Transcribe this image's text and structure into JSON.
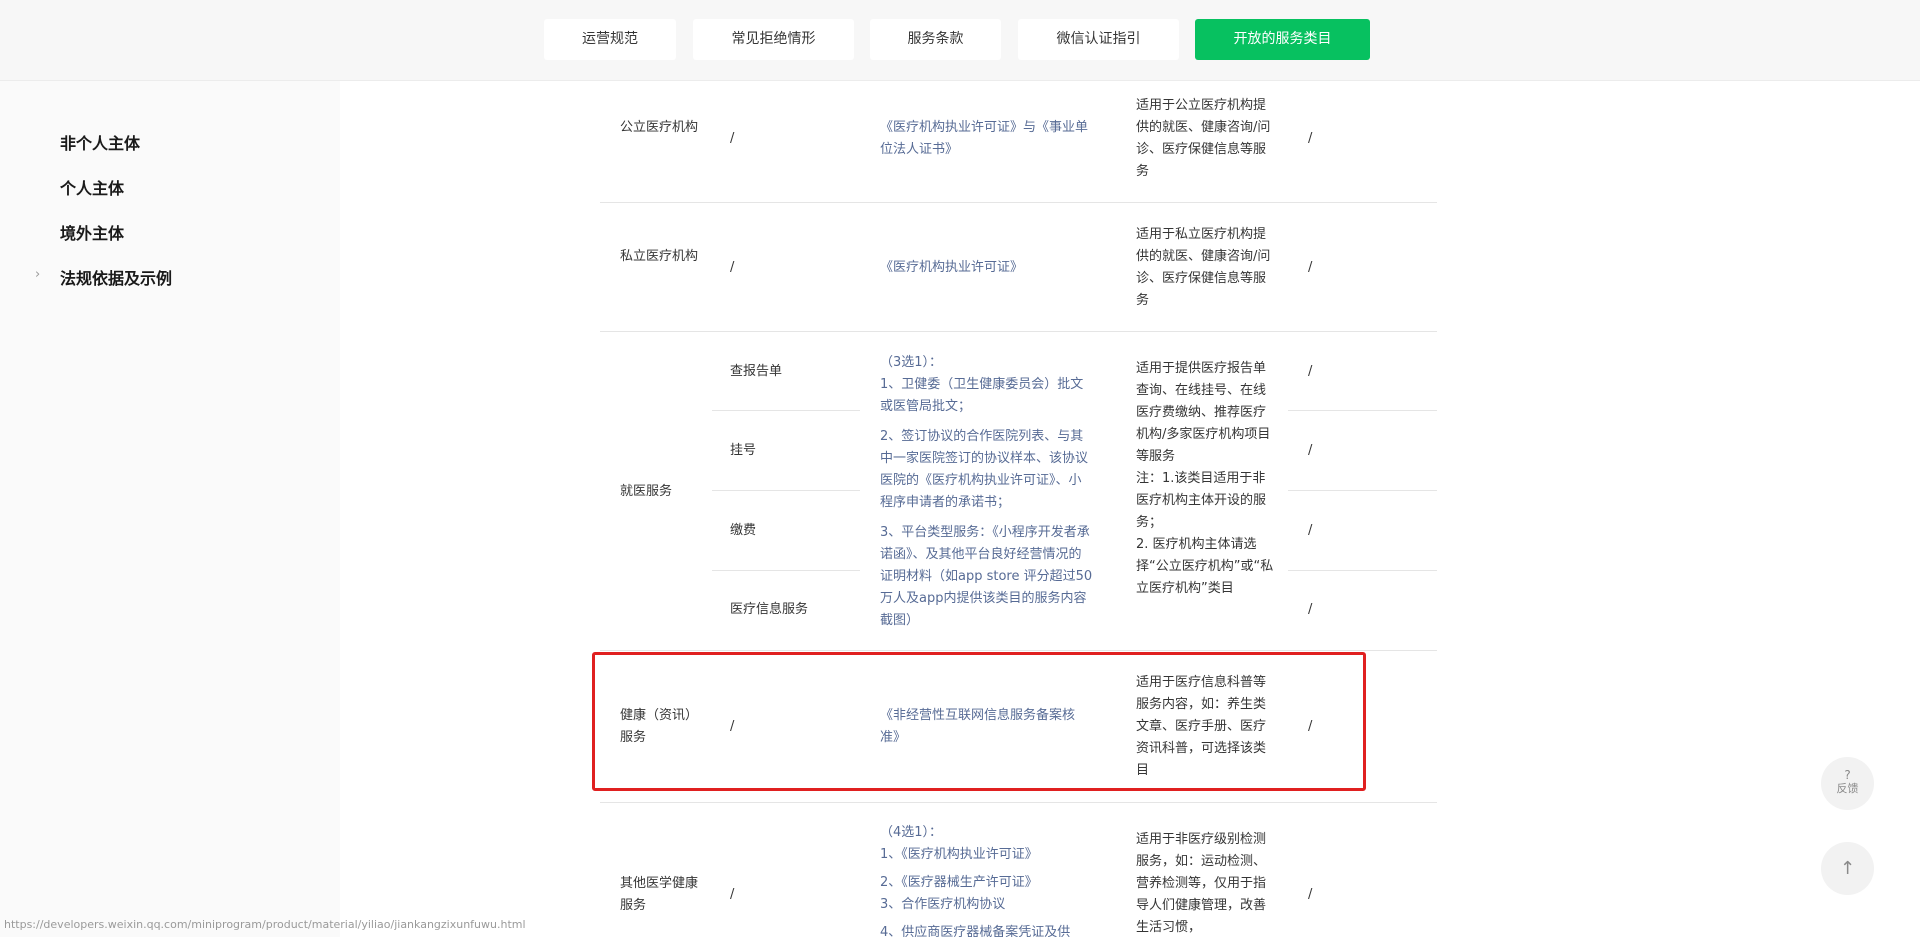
{
  "nav": {
    "buttons": [
      {
        "label": "运营规范"
      },
      {
        "label": "常见拒绝情形"
      },
      {
        "label": "服务条款"
      },
      {
        "label": "微信认证指引"
      },
      {
        "label": "开放的服务类目"
      }
    ]
  },
  "sidebar": {
    "items": [
      {
        "label": "非个人主体"
      },
      {
        "label": "个人主体"
      },
      {
        "label": "境外主体"
      },
      {
        "label": "法规依据及示例"
      }
    ],
    "caret": "›"
  },
  "table": {
    "slash": "/",
    "public": {
      "name": "公立医疗机构",
      "qual": "《医疗机构执业许可证》与《事业单位法人证书》",
      "desc": "适用于公立医疗机构提供的就医、健康咨询/问诊、医疗保健信息等服务"
    },
    "private": {
      "name": "私立医疗机构",
      "qual": "《医疗机构执业许可证》",
      "desc": "适用于私立医疗机构提供的就医、健康咨询/问诊、医疗保健信息等服务"
    },
    "medical": {
      "name": "就医服务",
      "subs": [
        "查报告单",
        "挂号",
        "缴费",
        "医疗信息服务"
      ],
      "qual_head": "（3选1）：",
      "qual_1": "1、卫健委（卫生健康委员会）批文或医管局批文；",
      "qual_2": "2、签订协议的合作医院列表、与其中一家医院签订的协议样本、该协议医院的《医疗机构执业许可证》、小程序申请者的承诺书；",
      "qual_3": "3、平台类型服务：《小程序开发者承诺函》、及其他平台良好经营情况的证明材料（如app store 评分超过50万人及app内提供该类目的服务内容截图）",
      "desc_1": "适用于提供医疗报告单查询、在线挂号、在线医疗费缴纳、推荐医疗机构/多家医疗机构项目等服务",
      "desc_2": "注：1.该类目适用于非医疗机构主体开设的服务；",
      "desc_3": "2. 医疗机构主体请选择“公立医疗机构”或“私立医疗机构”类目"
    },
    "health": {
      "name": "健康（资讯）服务",
      "qual": "《非经营性互联网信息服务备案核准》",
      "desc": "适用于医疗信息科普等服务内容，如：养生类文章、医疗手册、医疗资讯科普，可选择该类目"
    },
    "other": {
      "name": "其他医学健康服务",
      "qual_head": "（4选1）：",
      "qual_1": "1、《医疗机构执业许可证》",
      "qual_2": "2、《医疗器械生产许可证》",
      "qual_3": "3、合作医疗机构协议",
      "qual_4": "4、供应商医疗器械备案凭证及供",
      "desc": "适用于非医疗级别检测服务，如：运动检测、营养检测等，仅用于指导人们健康管理，改善生活习惯，"
    }
  },
  "float": {
    "feedback_q": "?",
    "feedback_label": "反馈",
    "top_arrow": "↑"
  },
  "status_url": "https://developers.weixin.qq.com/miniprogram/product/material/yiliao/jiankangzixunfuwu.html",
  "colors": {
    "accent": "#07c160",
    "link": "#576b95",
    "highlight": "#e02020"
  }
}
